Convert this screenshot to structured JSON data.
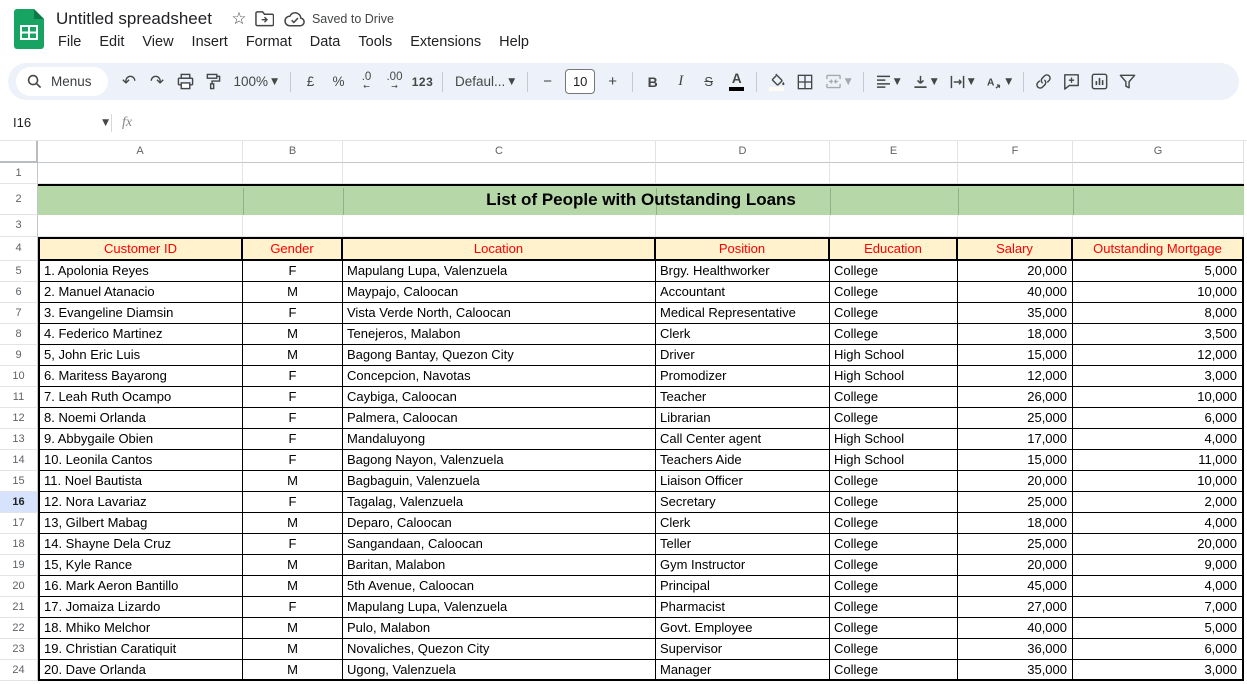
{
  "titlebar": {
    "title": "Untitled spreadsheet",
    "saved_status": "Saved to Drive",
    "menus": [
      "File",
      "Edit",
      "View",
      "Insert",
      "Format",
      "Data",
      "Tools",
      "Extensions",
      "Help"
    ]
  },
  "toolbar": {
    "menus_label": "Menus",
    "zoom_value": "100%",
    "currency": "£",
    "percent": "%",
    "decrease_decimal": ".0",
    "increase_decimal": ".00",
    "number_format": "123",
    "font_name": "Defaul...",
    "decrease_font": "−",
    "font_size": "10",
    "increase_font": "+",
    "bold": "B",
    "italic": "I",
    "strikethrough": "S",
    "text_color": "A",
    "text_color_swatch": "#000000",
    "fill_color_swatch": "#fdfdf5"
  },
  "formula_bar": {
    "name_box": "I16",
    "fx_label": "fx"
  },
  "colors": {
    "toolbar_bg": "#edf2fa",
    "title_band": "#b6d7a8",
    "header_band": "#fff2cc",
    "header_text": "#ff0000",
    "selected_row_header": "#d7e3fc",
    "sheets_logo_green": "#17a463"
  },
  "grid": {
    "column_headers": [
      "A",
      "B",
      "C",
      "D",
      "E",
      "F",
      "G"
    ],
    "selected_row": 16,
    "title": "List of People with Outstanding Loans",
    "header_cells": [
      "Customer ID",
      "Gender",
      "Location",
      "Position",
      "Education",
      "Salary",
      "Outstanding Mortgage"
    ],
    "rows": [
      {
        "n": 1,
        "type": "empty"
      },
      {
        "n": 2,
        "type": "title"
      },
      {
        "n": 3,
        "type": "empty"
      },
      {
        "n": 4,
        "type": "header"
      },
      {
        "n": 5,
        "type": "data",
        "cells": [
          "1. Apolonia Reyes",
          "F",
          "Mapulang Lupa, Valenzuela",
          "Brgy. Healthworker",
          "College",
          "20,000",
          "5,000"
        ]
      },
      {
        "n": 6,
        "type": "data",
        "cells": [
          "2. Manuel  Atanacio",
          "M",
          "Maypajo, Caloocan",
          "Accountant",
          "College",
          "40,000",
          "10,000"
        ]
      },
      {
        "n": 7,
        "type": "data",
        "cells": [
          "3. Evangeline Diamsin",
          "F",
          "Vista Verde North, Caloocan",
          "Medical Representative",
          "College",
          "35,000",
          "8,000"
        ]
      },
      {
        "n": 8,
        "type": "data",
        "cells": [
          "4. Federico Martinez",
          "M",
          "Tenejeros, Malabon",
          "Clerk",
          "College",
          "18,000",
          "3,500"
        ]
      },
      {
        "n": 9,
        "type": "data",
        "cells": [
          "5, John Eric Luis",
          "M",
          "Bagong Bantay, Quezon City",
          "Driver",
          "High School",
          "15,000",
          "12,000"
        ]
      },
      {
        "n": 10,
        "type": "data",
        "cells": [
          "6. Maritess Bayarong",
          "F",
          "Concepcion, Navotas",
          "Promodizer",
          "High School",
          "12,000",
          "3,000"
        ]
      },
      {
        "n": 11,
        "type": "data",
        "cells": [
          "7. Leah Ruth Ocampo",
          "F",
          "Caybiga, Caloocan",
          "Teacher",
          "College",
          "26,000",
          "10,000"
        ]
      },
      {
        "n": 12,
        "type": "data",
        "cells": [
          "8. Noemi Orlanda",
          "F",
          "Palmera, Caloocan",
          "Librarian",
          "College",
          "25,000",
          "6,000"
        ]
      },
      {
        "n": 13,
        "type": "data",
        "cells": [
          "9. Abbygaile Obien",
          "F",
          "Mandaluyong",
          "Call Center agent",
          "High School",
          "17,000",
          "4,000"
        ]
      },
      {
        "n": 14,
        "type": "data",
        "cells": [
          "10. Leonila Cantos",
          "F",
          "Bagong Nayon, Valenzuela",
          "Teachers Aide",
          "High School",
          "15,000",
          "11,000"
        ]
      },
      {
        "n": 15,
        "type": "data",
        "cells": [
          "11. Noel Bautista",
          "M",
          "Bagbaguin, Valenzuela",
          "Liaison Officer",
          "College",
          "20,000",
          "10,000"
        ]
      },
      {
        "n": 16,
        "type": "data",
        "cells": [
          "12. Nora Lavariaz",
          "F",
          "Tagalag, Valenzuela",
          "Secretary",
          "College",
          "25,000",
          "2,000"
        ]
      },
      {
        "n": 17,
        "type": "data",
        "cells": [
          "13, Gilbert Mabag",
          "M",
          "Deparo, Caloocan",
          "Clerk",
          "College",
          "18,000",
          "4,000"
        ]
      },
      {
        "n": 18,
        "type": "data",
        "cells": [
          "14. Shayne Dela Cruz",
          "F",
          "Sangandaan, Caloocan",
          "Teller",
          "College",
          "25,000",
          "20,000"
        ]
      },
      {
        "n": 19,
        "type": "data",
        "cells": [
          "15, Kyle Rance",
          "M",
          "Baritan, Malabon",
          "Gym Instructor",
          "College",
          "20,000",
          "9,000"
        ]
      },
      {
        "n": 20,
        "type": "data",
        "cells": [
          "16. Mark Aeron Bantillo",
          "M",
          "5th Avenue, Caloocan",
          "Principal",
          "College",
          "45,000",
          "4,000"
        ]
      },
      {
        "n": 21,
        "type": "data",
        "cells": [
          "17. Jomaiza Lizardo",
          "F",
          "Mapulang Lupa, Valenzuela",
          "Pharmacist",
          "College",
          "27,000",
          "7,000"
        ]
      },
      {
        "n": 22,
        "type": "data",
        "cells": [
          "18. Mhiko Melchor",
          "M",
          "Pulo, Malabon",
          "Govt. Employee",
          "College",
          "40,000",
          "5,000"
        ]
      },
      {
        "n": 23,
        "type": "data",
        "cells": [
          "19. Christian Caratiquit",
          "M",
          "Novaliches, Quezon City",
          "Supervisor",
          "College",
          "36,000",
          "6,000"
        ]
      },
      {
        "n": 24,
        "type": "data",
        "cells": [
          "20. Dave Orlanda",
          "M",
          "Ugong, Valenzuela",
          "Manager",
          "College",
          "35,000",
          "3,000"
        ]
      }
    ]
  }
}
